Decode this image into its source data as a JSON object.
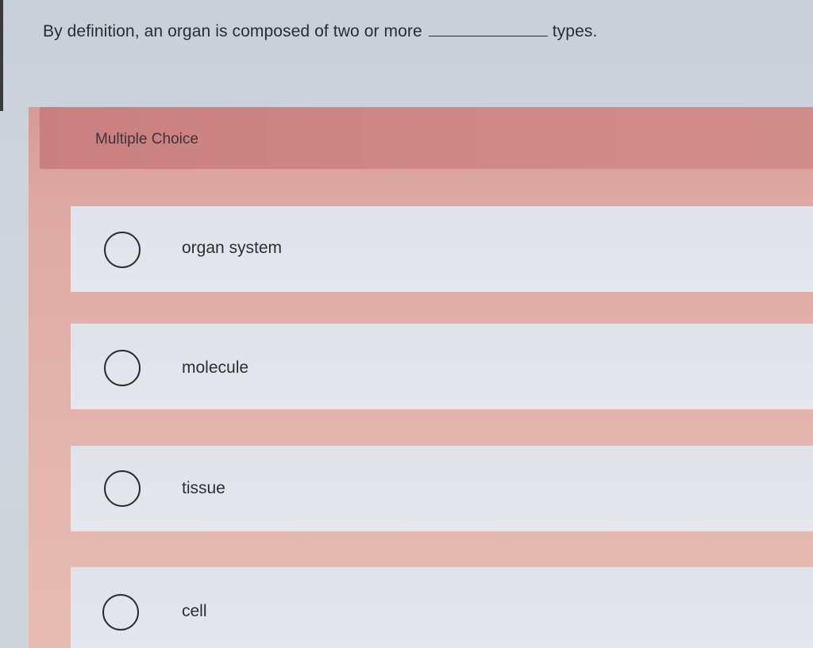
{
  "question": {
    "prefix": "By definition, an organ is composed of two or more",
    "suffix": "types."
  },
  "section": {
    "header_label": "Multiple Choice"
  },
  "options": [
    {
      "label": "organ system",
      "selected": false
    },
    {
      "label": "molecule",
      "selected": false
    },
    {
      "label": "tissue",
      "selected": false
    },
    {
      "label": "cell",
      "selected": false
    }
  ],
  "colors": {
    "header": "#cf8886",
    "panel": "#e2b4ad",
    "option_bg": "#e2e5ea"
  }
}
